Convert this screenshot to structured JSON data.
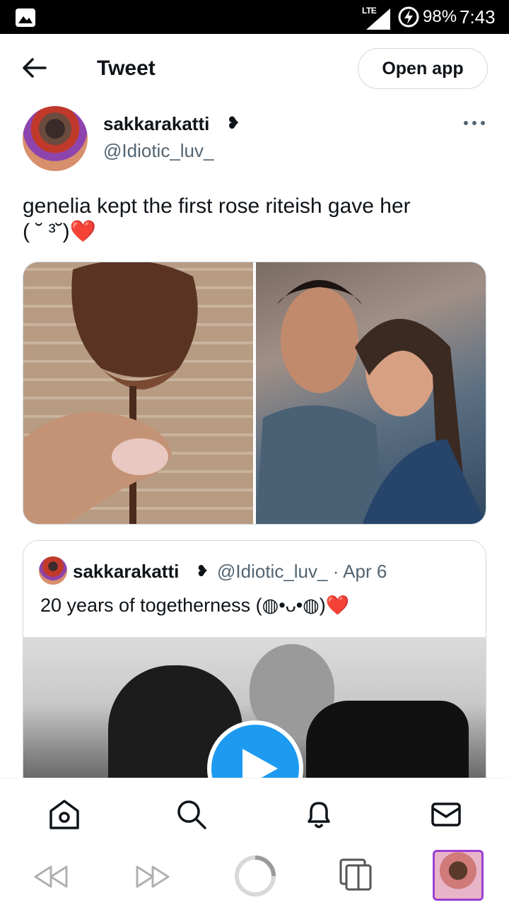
{
  "status_bar": {
    "network": "LTE",
    "battery": "98%",
    "time": "7:43"
  },
  "header": {
    "title": "Tweet",
    "open_app_label": "Open app"
  },
  "tweet": {
    "author_name": "sakkarakatti",
    "author_emoji": "❥",
    "author_handle": "@Idiotic_luv_",
    "text": "genelia kept the first rose riteish gave her\n( ˘ ³˘)❤️"
  },
  "quoted_tweet": {
    "author_name": "sakkarakatti",
    "author_emoji": "❥",
    "meta": "@Idiotic_luv_ · Apr 6",
    "text": "20 years of togetherness (◍•ᴗ•◍)❤️"
  },
  "bottom_nav": {
    "items": [
      "home-icon",
      "search-icon",
      "notifications-icon",
      "messages-icon"
    ]
  },
  "browser_bar": {
    "items": [
      "back-icon",
      "forward-icon",
      "reload-icon",
      "tabs-icon",
      "tab-thumbnail"
    ]
  },
  "colors": {
    "accent": "#1d9bf0",
    "text_primary": "#0f1419",
    "text_secondary": "#536471",
    "border": "#cfd9de"
  }
}
